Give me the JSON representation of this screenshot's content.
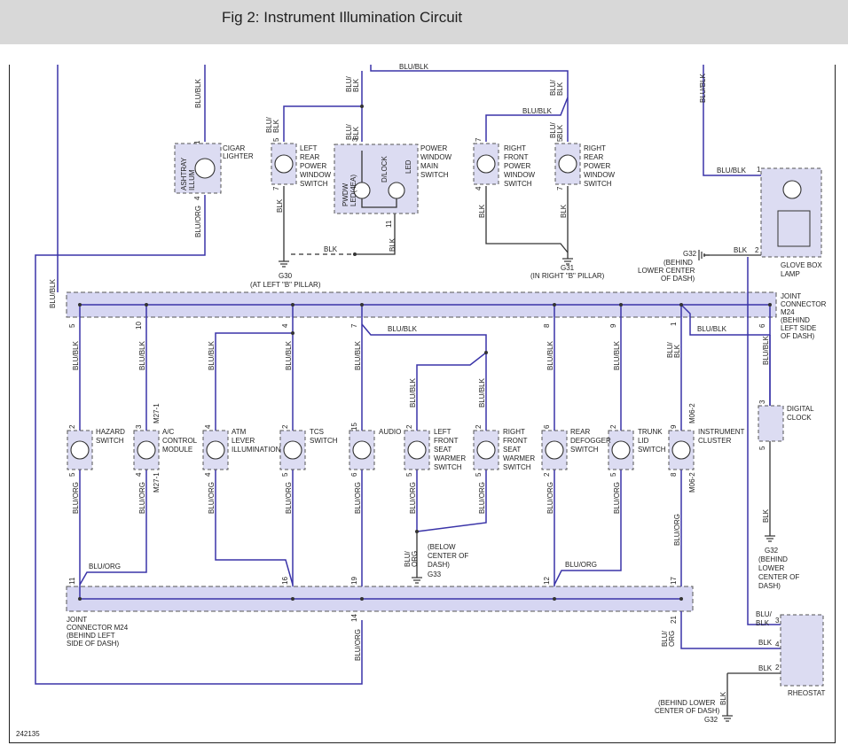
{
  "header": {
    "title": "Fig 2: Instrument Illumination Circuit"
  },
  "figure_id": "242135",
  "components": {
    "cigar": [
      "CIGAR",
      "LIGHTER"
    ],
    "ashtray": [
      "ASHTRAY",
      "ILLUM"
    ],
    "lr_window": [
      "LEFT",
      "REAR",
      "POWER",
      "WINDOW",
      "SWITCH"
    ],
    "pw_main": [
      "POWER",
      "WINDOW",
      "MAIN",
      "SWITCH"
    ],
    "pwdw": [
      "PWDW",
      "LED(4EA)"
    ],
    "dlock": "D/LOCK",
    "led": "LED",
    "rf_window": [
      "RIGHT",
      "FRONT",
      "POWER",
      "WINDOW",
      "SWITCH"
    ],
    "rr_window": [
      "RIGHT",
      "REAR",
      "POWER",
      "WINDOW",
      "SWITCH"
    ],
    "glovebox": [
      "GLOVE BOX",
      "LAMP"
    ],
    "hazard": [
      "HAZARD",
      "SWITCH"
    ],
    "ac": [
      "A/C",
      "CONTROL",
      "MODULE"
    ],
    "atm": [
      "ATM",
      "LEVER",
      "ILLUMINATION"
    ],
    "tcs": [
      "TCS",
      "SWITCH"
    ],
    "audio": "AUDIO",
    "lf_seat": [
      "LEFT",
      "FRONT",
      "SEAT",
      "WARMER",
      "SWITCH"
    ],
    "rf_seat": [
      "RIGHT",
      "FRONT",
      "SEAT",
      "WARMER",
      "SWITCH"
    ],
    "defogger": [
      "REAR",
      "DEFOGGER",
      "SWITCH"
    ],
    "trunk": [
      "TRUNK",
      "LID",
      "SWITCH"
    ],
    "cluster": [
      "INSTRUMENT",
      "CLUSTER"
    ],
    "digital_clock": [
      "DIGITAL",
      "CLOCK"
    ],
    "rheostat": "RHEOSTAT",
    "jc_top": [
      "JOINT",
      "CONNECTOR",
      "M24",
      "(BEHIND",
      "LEFT SIDE",
      "OF DASH)"
    ],
    "jc_bottom": [
      "JOINT",
      "CONNECTOR M24",
      "(BEHIND LEFT",
      "SIDE OF DASH)"
    ]
  },
  "connectors": {
    "m27_1": "M27-1",
    "m06_2": "M06-2"
  },
  "grounds": {
    "g30": "G30",
    "g30_loc": "(AT LEFT \"B\" PILLAR)",
    "g31": "G31",
    "g31_loc": "(IN RIGHT \"B\" PILLAR)",
    "g32_top": "G32",
    "g32_top_loc": [
      "(BEHIND",
      "LOWER CENTER",
      "OF DASH)"
    ],
    "g33": "G33",
    "g33_loc": [
      "(BELOW",
      "CENTER OF",
      "DASH)"
    ],
    "g32_mid": "G32",
    "g32_mid_loc": [
      "(BEHIND",
      "LOWER",
      "CENTER OF",
      "DASH)"
    ],
    "g32_bot": "G32",
    "g32_bot_loc": [
      "(BEHIND LOWER",
      "CENTER OF DASH)"
    ]
  },
  "wires": {
    "blu_blk": "BLU/BLK",
    "blu_org": "BLU/ORG",
    "blk": "BLK",
    "blu": "BLU/",
    "org": "ORG"
  },
  "pins": {
    "p1": "1",
    "p2": "2",
    "p3": "3",
    "p4": "4",
    "p5": "5",
    "p6": "6",
    "p7": "7",
    "p8": "8",
    "p9": "9",
    "p10": "10",
    "p11": "11",
    "p12": "12",
    "p14": "14",
    "p15": "15",
    "p16": "16",
    "p17": "17",
    "p19": "19",
    "p21": "21"
  },
  "colors": {
    "wire": "#3a34a8",
    "component_fill": "#dcdcf2",
    "header_bg": "#d8d8d8"
  }
}
